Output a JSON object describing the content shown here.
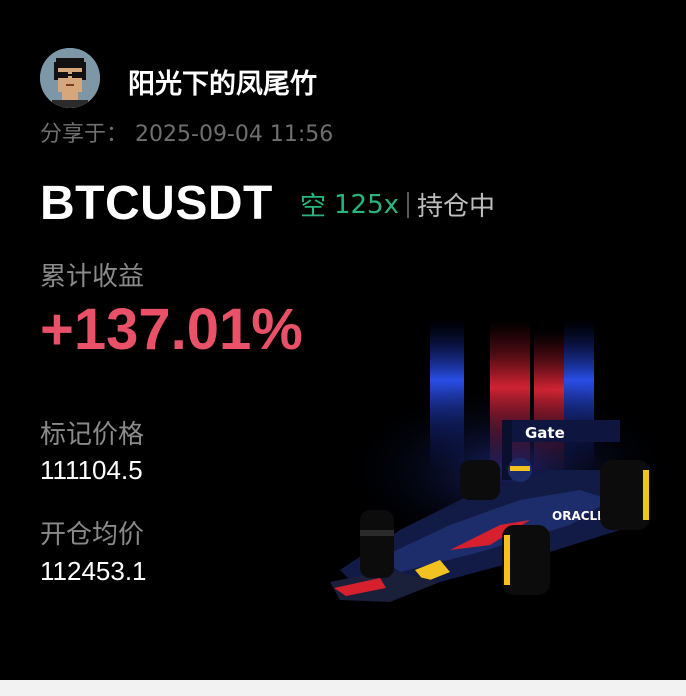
{
  "user": {
    "name": "阳光下的凤尾竹",
    "avatar_icon": "pixel-avatar-icon"
  },
  "share": {
    "label": "分享于：",
    "datetime": "2025-09-04 11:56"
  },
  "position": {
    "symbol": "BTCUSDT",
    "side": "空",
    "leverage": "125x",
    "status": "持仓中"
  },
  "pnl": {
    "label": "累计收益",
    "value": "+137.01%"
  },
  "prices": {
    "mark_label": "标记价格",
    "mark_value": "111104.5",
    "entry_label": "开仓均价",
    "entry_value": "112453.1"
  },
  "artwork": {
    "sponsor_text_top": "Gate",
    "sponsor_text_side": "ORACLE",
    "icon": "race-car-icon"
  },
  "colors": {
    "background": "#000000",
    "profit": "#e95168",
    "short_side": "#27b67f",
    "muted": "#8a8a8a"
  }
}
